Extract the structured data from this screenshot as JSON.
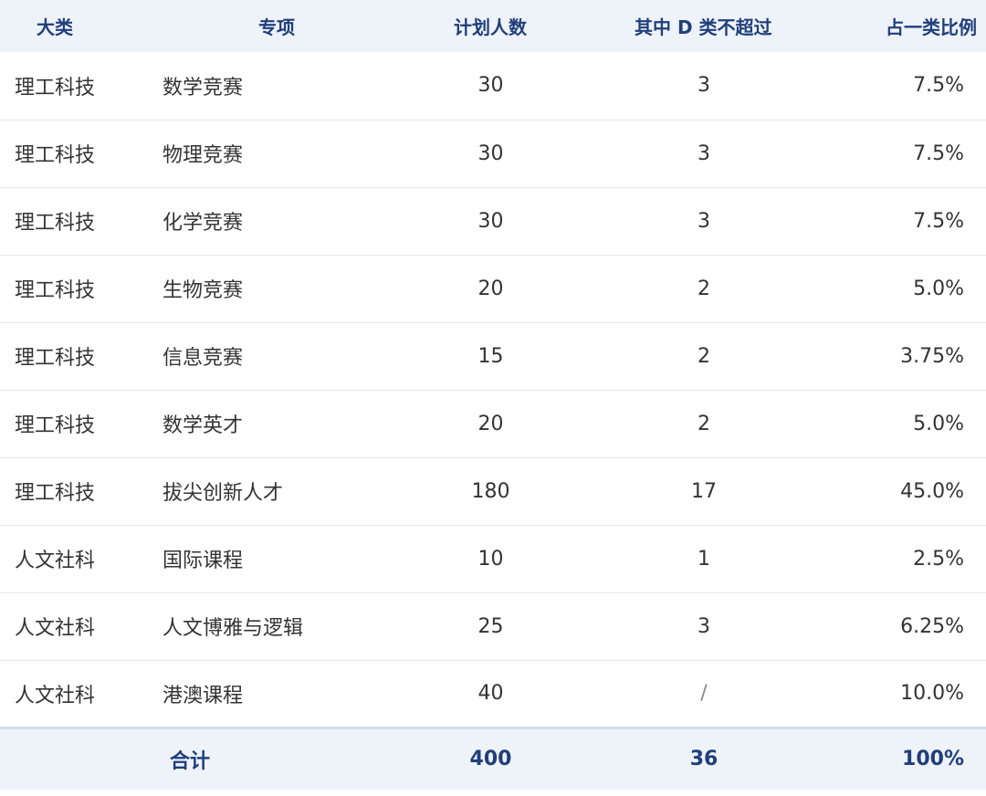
{
  "table": {
    "headers": {
      "category": "大类",
      "item": "专项",
      "plan": "计划人数",
      "d_max": "其中 D 类不超过",
      "ratio": "占一类比例"
    },
    "rows": [
      {
        "category": "理工科技",
        "item": "数学竞赛",
        "plan": "30",
        "d_max": "3",
        "ratio": "7.5%"
      },
      {
        "category": "理工科技",
        "item": "物理竞赛",
        "plan": "30",
        "d_max": "3",
        "ratio": "7.5%"
      },
      {
        "category": "理工科技",
        "item": "化学竞赛",
        "plan": "30",
        "d_max": "3",
        "ratio": "7.5%"
      },
      {
        "category": "理工科技",
        "item": "生物竞赛",
        "plan": "20",
        "d_max": "2",
        "ratio": "5.0%"
      },
      {
        "category": "理工科技",
        "item": "信息竞赛",
        "plan": "15",
        "d_max": "2",
        "ratio": "3.75%"
      },
      {
        "category": "理工科技",
        "item": "数学英才",
        "plan": "20",
        "d_max": "2",
        "ratio": "5.0%"
      },
      {
        "category": "理工科技",
        "item": "拔尖创新人才",
        "plan": "180",
        "d_max": "17",
        "ratio": "45.0%"
      },
      {
        "category": "人文社科",
        "item": "国际课程",
        "plan": "10",
        "d_max": "1",
        "ratio": "2.5%"
      },
      {
        "category": "人文社科",
        "item": "人文博雅与逻辑",
        "plan": "25",
        "d_max": "3",
        "ratio": "6.25%"
      },
      {
        "category": "人文社科",
        "item": "港澳课程",
        "plan": "40",
        "d_max": "/",
        "ratio": "10.0%"
      }
    ],
    "total": {
      "label": "合计",
      "plan": "400",
      "d_max": "36",
      "ratio": "100%"
    }
  },
  "colors": {
    "header_bg": "#eef2f9",
    "header_text": "#1f3f7a",
    "body_text": "#333333",
    "divider": "#e6e6e6"
  }
}
